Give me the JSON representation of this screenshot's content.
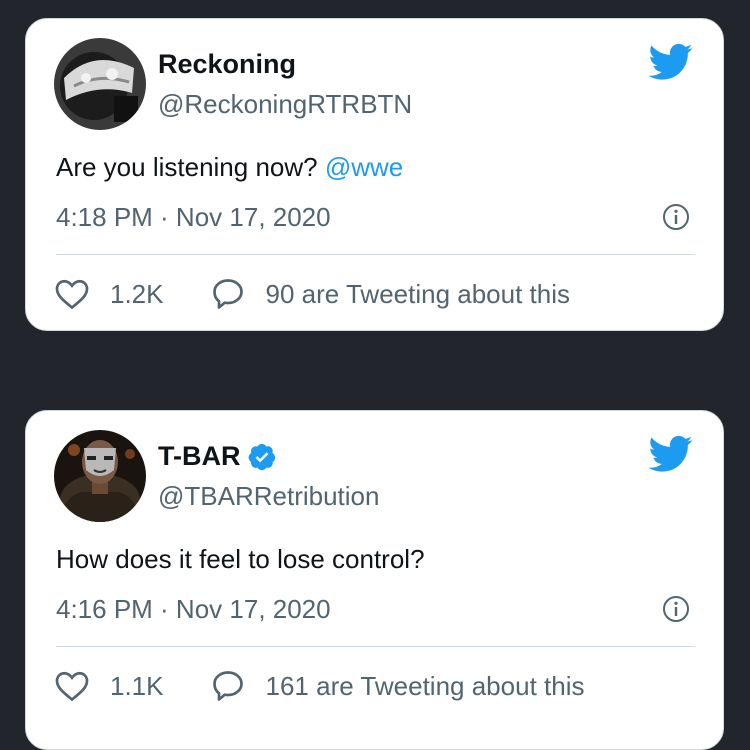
{
  "tweets": [
    {
      "display_name": "Reckoning",
      "verified": false,
      "handle": "@ReckoningRTRBTN",
      "text": "Are you listening now? ",
      "mention": "@wwe",
      "timestamp": "4:18 PM · Nov 17, 2020",
      "likes": "1.2K",
      "conversation": "90 are Tweeting about this"
    },
    {
      "display_name": "T-BAR",
      "verified": true,
      "handle": "@TBARRetribution",
      "text": "How does it feel to lose control?",
      "mention": "",
      "timestamp": "4:16 PM · Nov 17, 2020",
      "likes": "1.1K",
      "conversation": "161 are Tweeting about this"
    }
  ],
  "colors": {
    "background": "#22252b",
    "card": "#ffffff",
    "accent": "#1d9bf0",
    "secondary_text": "#536471",
    "primary_text": "#0f1419"
  },
  "icons": [
    "twitter-bird-icon",
    "heart-icon",
    "reply-bubble-icon",
    "info-icon",
    "verified-badge-icon"
  ]
}
